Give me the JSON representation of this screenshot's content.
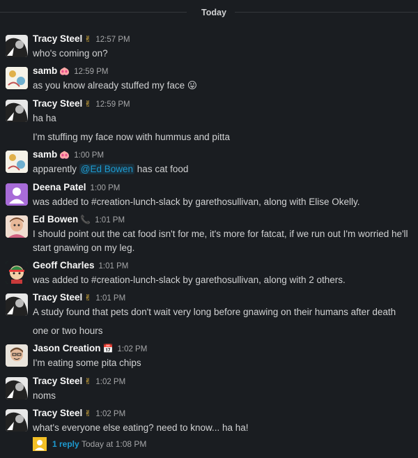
{
  "divider": {
    "label": "Today"
  },
  "messages": [
    {
      "name": "Tracy Steel",
      "status": "✌",
      "time": "12:57 PM",
      "lines": [
        "who's coming on?"
      ]
    },
    {
      "name": "samb",
      "status": "🐽",
      "time": "12:59 PM",
      "lines": [
        "as you know already stuffed my face 😛"
      ]
    },
    {
      "name": "Tracy Steel",
      "status": "✌",
      "time": "12:59 PM",
      "lines": [
        "ha ha",
        "I'm stuffing my face now with hummus and pitta"
      ]
    },
    {
      "name": "samb",
      "status": "🐽",
      "time": "1:00 PM",
      "pre": "apparently ",
      "mention": "@Ed Bowen",
      "post": " has cat food"
    },
    {
      "name": "Deena Patel",
      "time": "1:00 PM",
      "lines": [
        "was added to #creation-lunch-slack by garethosullivan, along with Elise Okelly."
      ]
    },
    {
      "name": "Ed Bowen",
      "status": "📞",
      "time": "1:01 PM",
      "lines": [
        "I should point out the cat food isn't for me, it's more for fatcat, if we run out I'm worried he'll",
        "start gnawing on my leg."
      ]
    },
    {
      "name": "Geoff Charles",
      "time": "1:01 PM",
      "lines": [
        "was added to #creation-lunch-slack by garethosullivan, along with 2 others."
      ]
    },
    {
      "name": "Tracy Steel",
      "status": "✌",
      "time": "1:01 PM",
      "lines": [
        "A study found that pets don't wait very long before gnawing on their humans after death",
        "one or two hours"
      ]
    },
    {
      "name": "Jason Creation",
      "status": "📅",
      "time": "1:02 PM",
      "lines": [
        "I'm eating some pita chips"
      ]
    },
    {
      "name": "Tracy Steel",
      "status": "✌",
      "time": "1:02 PM",
      "lines": [
        "noms"
      ]
    },
    {
      "name": "Tracy Steel",
      "status": "✌",
      "time": "1:02 PM",
      "lines": [
        "what's everyone else eating? need to know... ha ha!"
      ]
    }
  ],
  "thread": {
    "reply_count": "1 reply",
    "last_reply": "Today at 1:08 PM"
  },
  "colors": {
    "background": "#1a1d21",
    "link": "#1d9bd1",
    "text": "#d1d2d3"
  }
}
